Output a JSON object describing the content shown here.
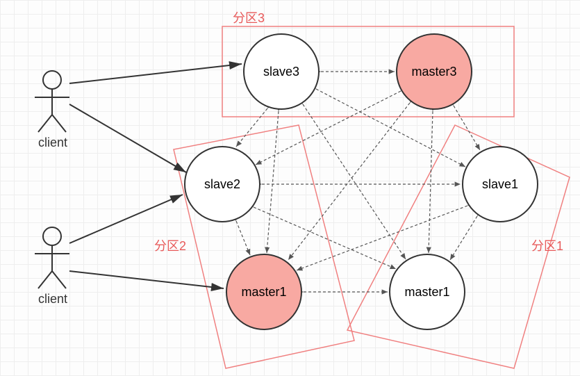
{
  "clients": {
    "top": "client",
    "bottom": "client"
  },
  "partitions": {
    "p1": "分区1",
    "p2": "分区2",
    "p3": "分区3"
  },
  "nodes": {
    "slave3": "slave3",
    "master3": "master3",
    "slave2": "slave2",
    "slave1": "slave1",
    "master1_left": "master1",
    "master1_right": "master1"
  },
  "chart_data": {
    "type": "diagram",
    "title": "",
    "actors": [
      "client",
      "client"
    ],
    "partitions": [
      {
        "name": "分区3",
        "nodes": [
          "slave3",
          "master3"
        ]
      },
      {
        "name": "分区2",
        "nodes": [
          "slave2",
          "master1"
        ]
      },
      {
        "name": "分区1",
        "nodes": [
          "slave1",
          "master1"
        ]
      }
    ],
    "solid_edges": [
      [
        "client_top",
        "slave3"
      ],
      [
        "client_top",
        "slave2"
      ],
      [
        "client_bottom",
        "slave2"
      ],
      [
        "client_bottom",
        "master1_left"
      ]
    ],
    "dotted_edges_note": "all six nodes are fully interconnected by dotted bidirectional links"
  }
}
